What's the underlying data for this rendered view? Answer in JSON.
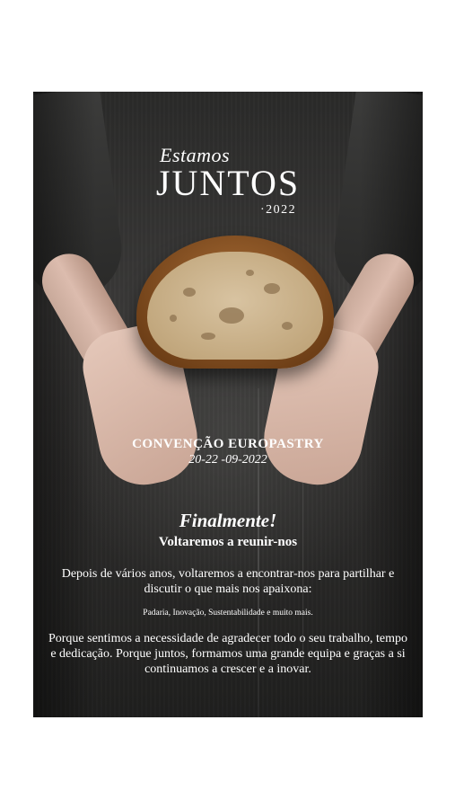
{
  "brand": {
    "script": "Estamos",
    "big": "JUNTOS",
    "year": "·2022"
  },
  "event": {
    "title": "CONVENÇÃO EUROPASTRY",
    "date": "20-22 -09-2022"
  },
  "headline": "Finalmente!",
  "subheadline": "Voltaremos a reunir-nos",
  "paragraph1": "Depois de vários anos, voltaremos a encontrar-nos para partilhar e discutir o que mais nos apaixona:",
  "topics": "Padaria, Inovação, Sustentabilidade e muito mais.",
  "paragraph2": "Porque sentimos a necessidade de agradecer todo o seu trabalho, tempo e dedicação. Porque juntos, formamos uma grande equipa e graças a si continuamos a crescer e a inovar.",
  "colors": {
    "background": "#2e2d2c",
    "text": "#ffffff",
    "crust": "#8a5224",
    "crumb": "#d8c3a1"
  }
}
